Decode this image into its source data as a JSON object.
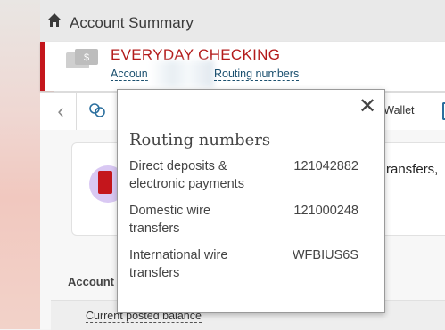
{
  "header": {
    "title": "Account Summary"
  },
  "account": {
    "name": "EVERYDAY CHECKING",
    "account_link": "Accoun",
    "routing_link": "Routing numbers"
  },
  "toolbar": {
    "wallet_label": "l Wallet"
  },
  "transfer": {
    "text": "ransfers,"
  },
  "accounts": {
    "label": "Account",
    "balance_label": "Current posted balance"
  },
  "popover": {
    "title": "Routing numbers",
    "rows": [
      {
        "label_line1": "Direct deposits &",
        "label_line2": "electronic payments",
        "value": "121042882"
      },
      {
        "label_line1": "Domestic wire",
        "label_line2": "transfers",
        "value": "121000248"
      },
      {
        "label_line1": "International wire",
        "label_line2": "transfers",
        "value": "WFBIUS6S"
      }
    ]
  },
  "colors": {
    "brand_red": "#c4161c",
    "link_blue": "#1a4f6e"
  },
  "icons": [
    "home-icon",
    "bill-pay-icon",
    "transfer-icon",
    "close-icon",
    "chevron-left-icon",
    "door-icon"
  ]
}
